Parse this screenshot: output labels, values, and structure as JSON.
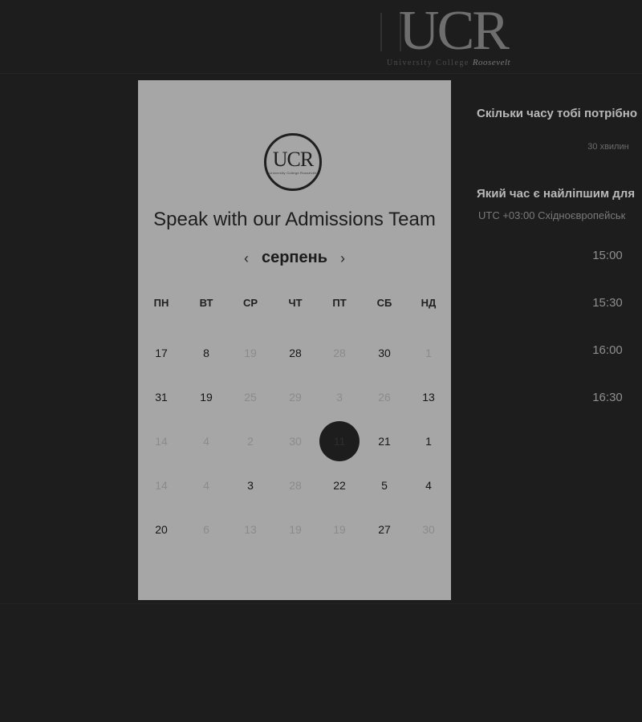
{
  "header": {
    "logo_mark": "UCR",
    "logo_subtitle": "University College",
    "logo_subtitle_script": "Roosevelt"
  },
  "card": {
    "logo_mark": "UCR",
    "logo_subtitle": "University College Roosevelt",
    "title": "Speak with our Admissions Team",
    "month": "серпень",
    "prev_symbol": "‹",
    "next_symbol": "›",
    "weekdays": [
      "ПН",
      "ВТ",
      "СР",
      "ЧТ",
      "ПТ",
      "СБ",
      "НД"
    ],
    "weeks": [
      [
        {
          "d": "17",
          "on": true
        },
        {
          "d": "8",
          "on": true
        },
        {
          "d": "19",
          "on": false
        },
        {
          "d": "28",
          "on": true
        },
        {
          "d": "28",
          "on": false
        },
        {
          "d": "30",
          "on": true
        },
        {
          "d": "1",
          "on": false
        }
      ],
      [
        {
          "d": "31",
          "on": true
        },
        {
          "d": "19",
          "on": true
        },
        {
          "d": "25",
          "on": false
        },
        {
          "d": "29",
          "on": false
        },
        {
          "d": "3",
          "on": false
        },
        {
          "d": "26",
          "on": false
        },
        {
          "d": "13",
          "on": true
        }
      ],
      [
        {
          "d": "14",
          "on": false
        },
        {
          "d": "4",
          "on": false
        },
        {
          "d": "2",
          "on": false
        },
        {
          "d": "30",
          "on": false
        },
        {
          "d": "11",
          "on": false,
          "selected": true
        },
        {
          "d": "21",
          "on": true
        },
        {
          "d": "1",
          "on": true
        }
      ],
      [
        {
          "d": "14",
          "on": false
        },
        {
          "d": "4",
          "on": false
        },
        {
          "d": "3",
          "on": true
        },
        {
          "d": "28",
          "on": false
        },
        {
          "d": "22",
          "on": true
        },
        {
          "d": "5",
          "on": true
        },
        {
          "d": "4",
          "on": true
        }
      ],
      [
        {
          "d": "20",
          "on": true
        },
        {
          "d": "6",
          "on": false
        },
        {
          "d": "13",
          "on": false
        },
        {
          "d": "19",
          "on": false
        },
        {
          "d": "19",
          "on": false
        },
        {
          "d": "27",
          "on": true
        },
        {
          "d": "30",
          "on": false
        }
      ]
    ]
  },
  "panel": {
    "duration_question": "Скільки часу тобі потрібно",
    "duration_option": "30 хвилин",
    "time_question": "Який час є найліпшим для",
    "timezone": "UTC +03:00 Східноєвропейськ",
    "slots": [
      "15:00",
      "15:30",
      "16:00",
      "16:30"
    ]
  },
  "colors": {
    "background": "#1d1d1e",
    "card": "#a6a6a6",
    "selected_day": "#1d1d1d"
  }
}
